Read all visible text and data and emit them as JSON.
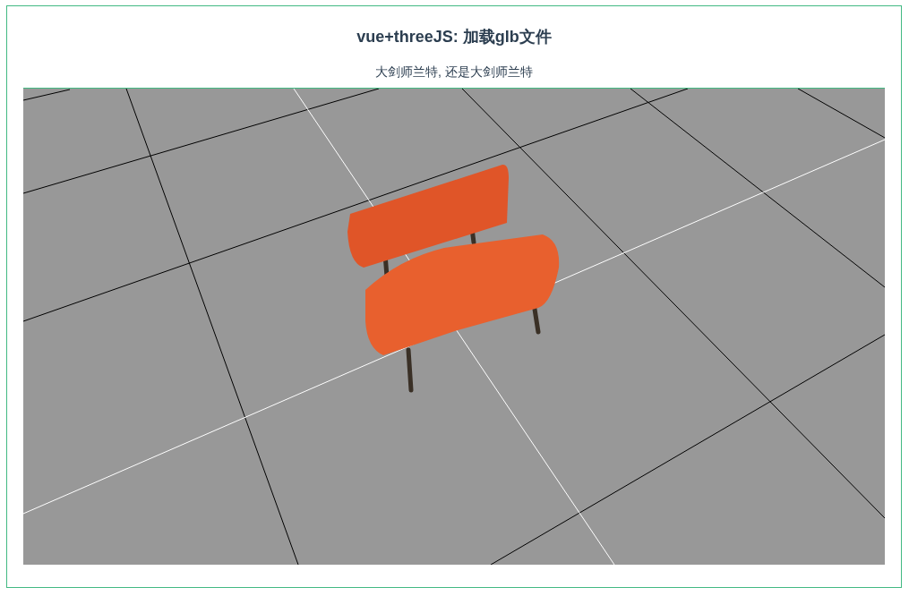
{
  "page": {
    "title": "vue+threeJS: 加载glb文件",
    "subtitle": "大剑师兰特, 还是大剑师兰特"
  }
}
